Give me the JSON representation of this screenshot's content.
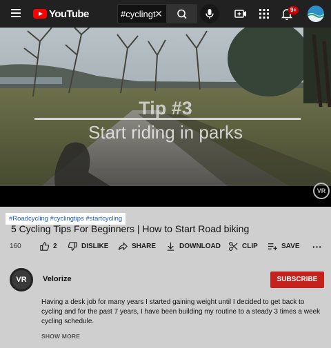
{
  "header": {
    "logo_text": "YouTube",
    "search_value": "#cyclingt",
    "notification_count": "9+"
  },
  "video": {
    "caption_tip": "Tip #3",
    "caption_sub": "Start riding in parks",
    "watermark": "VR"
  },
  "details": {
    "hashtags": "#Roadcycling #cyclingtips #startcycling",
    "title": "5 Cycling Tips For Beginners | How to Start Road biking",
    "views": "160",
    "like_count": "2",
    "dislike_label": "DISLIKE",
    "share_label": "SHARE",
    "download_label": "DOWNLOAD",
    "clip_label": "CLIP",
    "save_label": "SAVE"
  },
  "channel": {
    "avatar_text": "VR",
    "name": "Velorize",
    "subscribe_label": "SUBSCRIBE"
  },
  "description": {
    "text": "Having a desk job for many years I started gaining weight until I decided to get back to cycling and for the past 7 years, I have been building my routine to a steady 3 times a week cycling schedule.",
    "show_more_label": "SHOW MORE"
  },
  "colors": {
    "brand_red": "#ff0000",
    "subscribe_red": "#c4221d",
    "hashtag_blue": "#1a5bd6"
  }
}
